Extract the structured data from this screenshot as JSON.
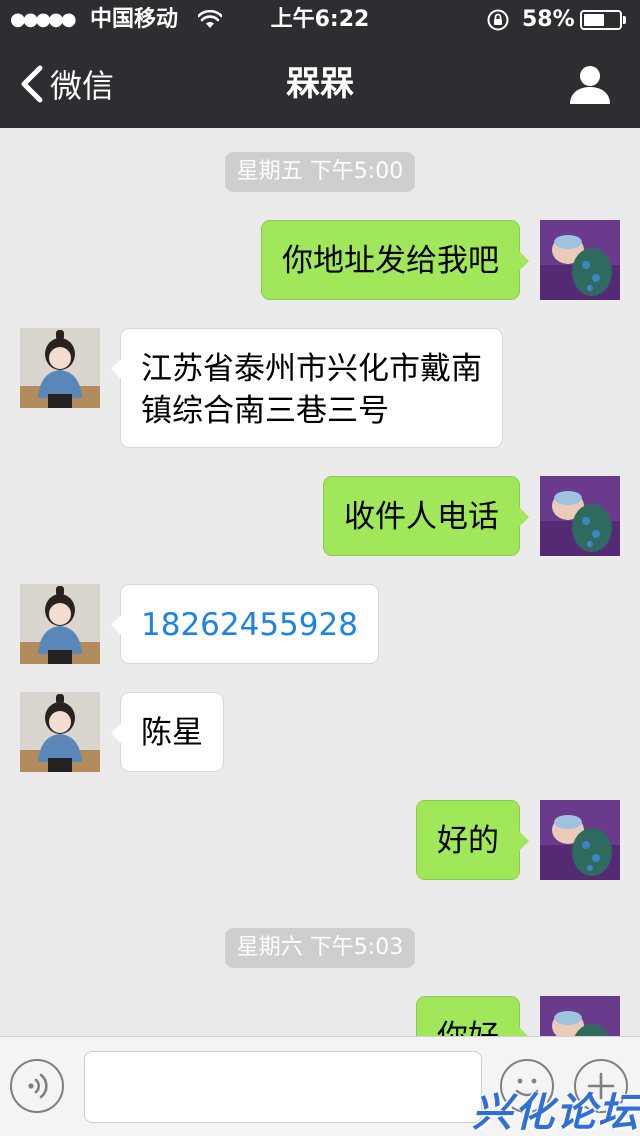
{
  "status_bar": {
    "signal": "●●●●●",
    "carrier": "中国移动",
    "time": "上午6:22",
    "battery_percent": "58%",
    "battery_level": 0.58
  },
  "nav": {
    "back_label": "微信",
    "title": "槑槑",
    "back_icon": "chevron-left-icon",
    "profile_icon": "person-icon"
  },
  "timestamps": [
    "星期五 下午5:00",
    "星期六 下午5:03"
  ],
  "messages": [
    {
      "from": "me",
      "text": "你地址发给我吧"
    },
    {
      "from": "them",
      "text": "江苏省泰州市兴化市戴南\n镇综合南三巷三号"
    },
    {
      "from": "me",
      "text": "收件人电话"
    },
    {
      "from": "them",
      "text": "18262455928"
    },
    {
      "from": "them",
      "text": "陈星"
    },
    {
      "from": "me",
      "text": "好的"
    },
    {
      "from": "me",
      "text": "你好"
    }
  ],
  "input_bar": {
    "voice_icon": "voice-icon",
    "emoji_icon": "emoji-icon",
    "plus_icon": "plus-icon",
    "text_value": ""
  },
  "watermark": "兴化论坛",
  "colors": {
    "nav_bg": "#2d2e32",
    "chat_bg": "#ebebeb",
    "bubble_me": "#a0e75a",
    "bubble_them": "#ffffff",
    "phone_link": "#1d82e6",
    "watermark": "#2f6fd8"
  }
}
